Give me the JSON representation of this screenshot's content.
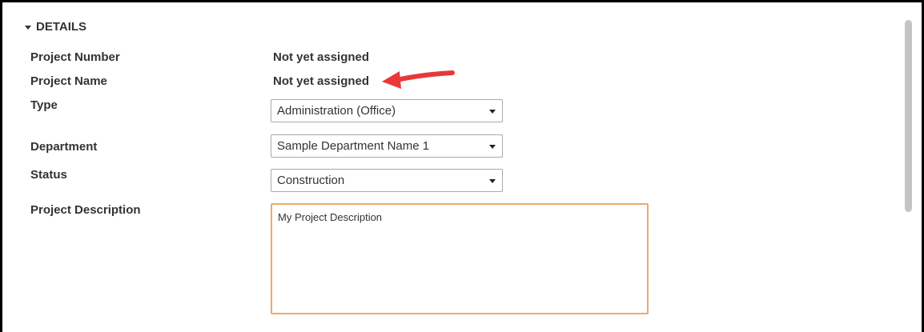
{
  "section": {
    "title": "DETAILS"
  },
  "fields": {
    "project_number": {
      "label": "Project Number",
      "value": "Not yet assigned"
    },
    "project_name": {
      "label": "Project Name",
      "value": "Not yet assigned"
    },
    "type": {
      "label": "Type",
      "selected": "Administration (Office)"
    },
    "department": {
      "label": "Department",
      "selected": "Sample Department Name 1"
    },
    "status": {
      "label": "Status",
      "selected": "Construction"
    },
    "description": {
      "label": "Project Description",
      "value": "My Project Description"
    }
  },
  "colors": {
    "annotation_arrow": "#e8383a",
    "textarea_focus_border": "#f0a868"
  }
}
